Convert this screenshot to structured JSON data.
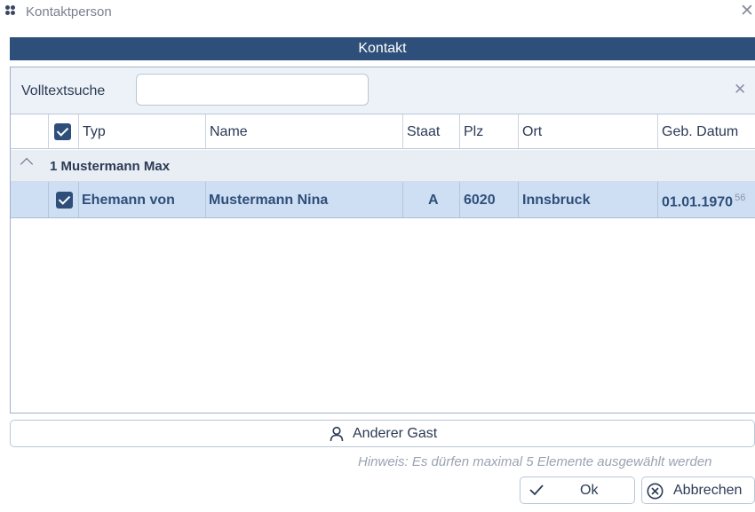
{
  "window": {
    "title": "Kontaktperson"
  },
  "section": {
    "header": "Kontakt"
  },
  "search": {
    "label": "Volltextsuche",
    "value": "",
    "placeholder": ""
  },
  "table": {
    "columns": [
      "Typ",
      "Name",
      "Staat",
      "Plz",
      "Ort",
      "Geb. Datum"
    ],
    "group": {
      "label": "1 Mustermann Max",
      "expanded": true
    },
    "rows": [
      {
        "checked": true,
        "typ": "Ehemann von",
        "name": "Mustermann Nina",
        "staat": "A",
        "plz": "6020",
        "ort": "Innsbruck",
        "geb_datum": "01.01.1970",
        "age": "56"
      }
    ]
  },
  "buttons": {
    "other_guest": "Anderer Gast",
    "ok": "Ok",
    "cancel": "Abbrechen"
  },
  "hint": "Hinweis: Es dürfen maximal 5 Elemente ausgewählt werden",
  "colors": {
    "accent": "#2e4f7a",
    "selected_row": "#cfdff3",
    "group_row": "#e9eef5"
  },
  "icons": {
    "app": "app-dots-icon",
    "close": "close-icon",
    "clear": "clear-icon",
    "person": "person-icon",
    "ok": "check-icon",
    "cancel": "circle-x-icon"
  }
}
